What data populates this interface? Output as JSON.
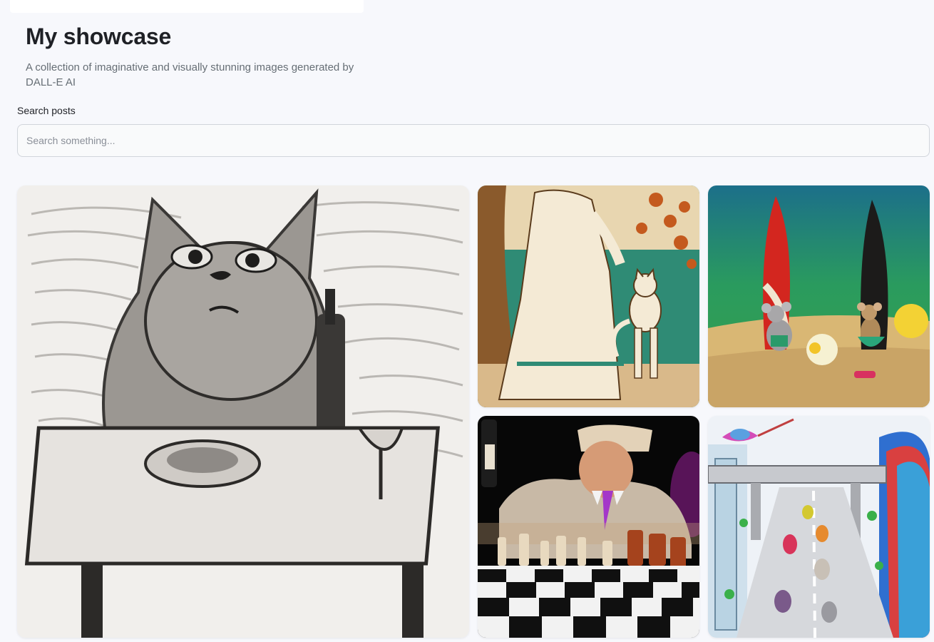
{
  "header": {
    "title": "My showcase",
    "subtitle": "A collection of imaginative and visually stunning images generated by DALL-E AI"
  },
  "search": {
    "label": "Search posts",
    "placeholder": "Search something...",
    "value": ""
  },
  "posts": [
    {
      "image": "cat-dinner-sketch-image"
    },
    {
      "image": "woman-and-cat-illustration-image"
    },
    {
      "image": "mice-surfboards-beach-image"
    },
    {
      "image": "chess-player-wine-image"
    },
    {
      "image": "futuristic-city-highway-image"
    }
  ]
}
